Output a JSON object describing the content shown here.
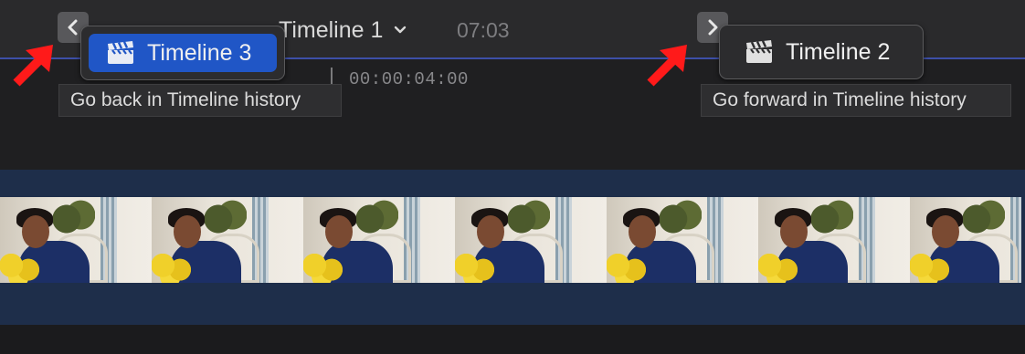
{
  "toolbar": {
    "timeline_title": "Timeline 1",
    "timecode": "07:03",
    "back_button_icon": "chevron-left-icon",
    "forward_button_icon": "chevron-right-icon",
    "title_dropdown_icon": "chevron-down-icon"
  },
  "history": {
    "back": {
      "item_label": "Timeline 3",
      "item_icon": "clapperboard-icon",
      "tooltip": "Go back in Timeline history"
    },
    "forward": {
      "item_label": "Timeline 2",
      "item_icon": "clapperboard-icon",
      "tooltip": "Go forward in Timeline history"
    }
  },
  "ruler": {
    "timecode": "00:00:04:00"
  },
  "clip": {
    "frame_count": 7
  },
  "colors": {
    "selected_item": "#2056c6",
    "annotation_arrow": "#ff1a1a",
    "track_background": "#1e2e4a"
  }
}
